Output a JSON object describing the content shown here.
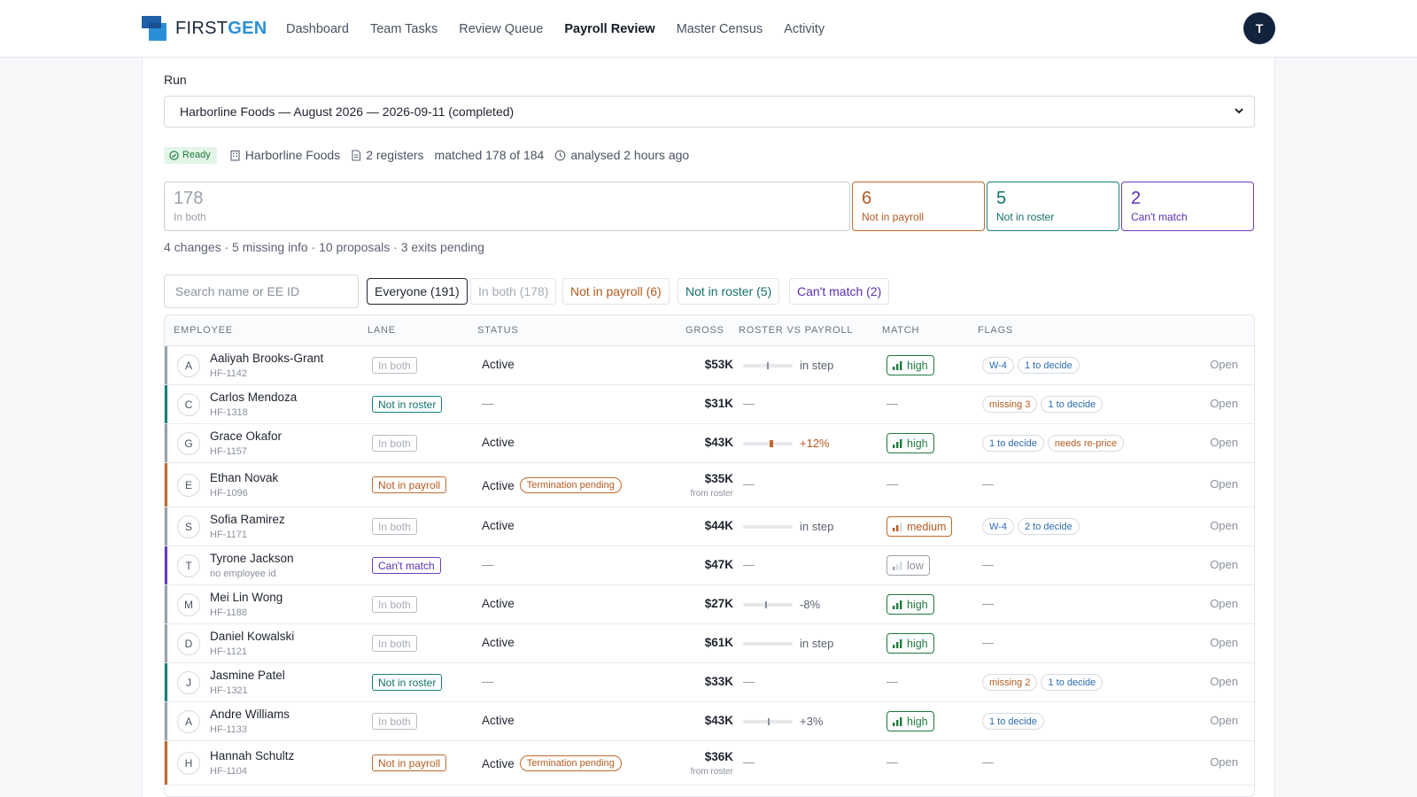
{
  "brand": {
    "first": "FIRST",
    "gen": "GEN"
  },
  "nav": [
    "Dashboard",
    "Team Tasks",
    "Review Queue",
    "Payroll Review",
    "Master Census",
    "Activity"
  ],
  "nav_active": "Payroll Review",
  "user_initial": "T",
  "run": {
    "label": "Run",
    "selected": "Harborline Foods — August 2026 — 2026-09-11 (completed)"
  },
  "meta": {
    "status": "Ready",
    "company": "Harborline Foods",
    "registers": "2 registers",
    "matched": "matched 178 of 184",
    "analysed": "analysed 2 hours ago"
  },
  "cards": {
    "both": {
      "num": "178",
      "label": "In both"
    },
    "notpay": {
      "num": "6",
      "label": "Not in payroll"
    },
    "notroster": {
      "num": "5",
      "label": "Not in roster"
    },
    "cant": {
      "num": "2",
      "label": "Can't match"
    }
  },
  "summary": "4 changes · 5 missing info · 10 proposals · 3 exits pending",
  "search_placeholder": "Search name or EE ID",
  "filters": {
    "all": "Everyone (191)",
    "both": "In both (178)",
    "pay": "Not in payroll (6)",
    "roster": "Not in roster (5)",
    "cant": "Can't match (2)"
  },
  "columns": {
    "employee": "EMPLOYEE",
    "lane": "LANE",
    "status": "STATUS",
    "gross": "GROSS",
    "rvp": "ROSTER VS PAYROLL",
    "match": "MATCH",
    "flags": "FLAGS"
  },
  "dash": "—",
  "open_label": "Open",
  "from_roster": "from roster",
  "rows": [
    {
      "initial": "A",
      "name": "Aaliyah Brooks-Grant",
      "id": "HF-1142",
      "lane": "In both",
      "lane_type": "both",
      "status": "Active",
      "gross": "$53K",
      "rvp": "in step",
      "rvp_tick": 0.5,
      "match": "high",
      "flags": [
        {
          "t": "W-4",
          "c": "blue"
        },
        {
          "t": "1 to decide",
          "c": "blue"
        }
      ]
    },
    {
      "initial": "C",
      "name": "Carlos Mendoza",
      "id": "HF-1318",
      "lane": "Not in roster",
      "lane_type": "notroster",
      "status": "—",
      "gross": "$31K",
      "rvp": null,
      "match": null,
      "flags": [
        {
          "t": "missing 3",
          "c": "orange"
        },
        {
          "t": "1 to decide",
          "c": "blue"
        }
      ]
    },
    {
      "initial": "G",
      "name": "Grace Okafor",
      "id": "HF-1157",
      "lane": "In both",
      "lane_type": "both",
      "status": "Active",
      "gross": "$43K",
      "rvp": "+12%",
      "rvp_tick": 0.55,
      "rvp_up": true,
      "match": "high",
      "flags": [
        {
          "t": "1 to decide",
          "c": "blue"
        },
        {
          "t": "needs re-price",
          "c": "orange"
        }
      ]
    },
    {
      "initial": "E",
      "name": "Ethan Novak",
      "id": "HF-1096",
      "lane": "Not in payroll",
      "lane_type": "notpay",
      "status": "Active",
      "term": "Termination pending",
      "gross": "$35K",
      "from_roster": true,
      "rvp": null,
      "match": null,
      "flags": []
    },
    {
      "initial": "S",
      "name": "Sofia Ramirez",
      "id": "HF-1171",
      "lane": "In both",
      "lane_type": "both",
      "status": "Active",
      "gross": "$44K",
      "rvp": "in step",
      "rvp_tick": null,
      "match": "medium",
      "flags": [
        {
          "t": "W-4",
          "c": "blue"
        },
        {
          "t": "2 to decide",
          "c": "blue"
        }
      ]
    },
    {
      "initial": "T",
      "name": "Tyrone Jackson",
      "id": "no employee id",
      "lane": "Can't match",
      "lane_type": "cant",
      "status": "—",
      "gross": "$47K",
      "rvp": null,
      "match": "low",
      "flags": []
    },
    {
      "initial": "M",
      "name": "Mei Lin Wong",
      "id": "HF-1188",
      "lane": "In both",
      "lane_type": "both",
      "status": "Active",
      "gross": "$27K",
      "rvp": "-8%",
      "rvp_tick": 0.46,
      "match": "high",
      "flags": []
    },
    {
      "initial": "D",
      "name": "Daniel Kowalski",
      "id": "HF-1121",
      "lane": "In both",
      "lane_type": "both",
      "status": "Active",
      "gross": "$61K",
      "rvp": "in step",
      "rvp_tick": null,
      "match": "high",
      "flags": []
    },
    {
      "initial": "J",
      "name": "Jasmine Patel",
      "id": "HF-1321",
      "lane": "Not in roster",
      "lane_type": "notroster",
      "status": "—",
      "gross": "$33K",
      "rvp": null,
      "match": null,
      "flags": [
        {
          "t": "missing 2",
          "c": "orange"
        },
        {
          "t": "1 to decide",
          "c": "blue"
        }
      ]
    },
    {
      "initial": "A",
      "name": "Andre Williams",
      "id": "HF-1133",
      "lane": "In both",
      "lane_type": "both",
      "status": "Active",
      "gross": "$43K",
      "rvp": "+3%",
      "rvp_tick": 0.51,
      "match": "high",
      "flags": [
        {
          "t": "1 to decide",
          "c": "blue"
        }
      ]
    },
    {
      "initial": "H",
      "name": "Hannah Schultz",
      "id": "HF-1104",
      "lane": "Not in payroll",
      "lane_type": "notpay",
      "status": "Active",
      "term": "Termination pending",
      "gross": "$36K",
      "from_roster": true,
      "rvp": null,
      "match": null,
      "flags": []
    }
  ]
}
